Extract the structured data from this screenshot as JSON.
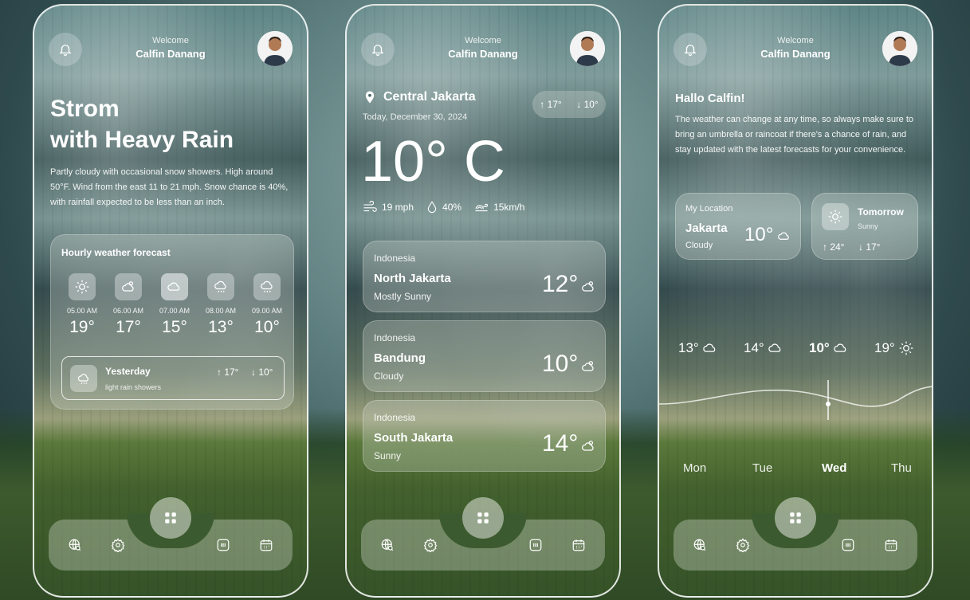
{
  "user": {
    "welcome_label": "Welcome",
    "name": "Calfin Danang"
  },
  "screen1": {
    "title_line1": "Strom",
    "title_line2": "with Heavy Rain",
    "description": "Partly cloudy with occasional snow showers. High around 50°F. Wind from the east 11 to 21 mph. Snow chance is 40%, with rainfall expected to be less than an inch.",
    "hourly_title": "Hourly weather forecast",
    "hourly": [
      {
        "time": "05.00 AM",
        "temp": "19°",
        "icon": "sun-icon"
      },
      {
        "time": "06.00 AM",
        "temp": "17°",
        "icon": "partly-cloudy-icon"
      },
      {
        "time": "07.00 AM",
        "temp": "15°",
        "icon": "cloud-icon"
      },
      {
        "time": "08.00 AM",
        "temp": "13°",
        "icon": "rain-cloud-icon"
      },
      {
        "time": "09.00 AM",
        "temp": "10°",
        "icon": "rain-cloud-icon"
      }
    ],
    "yesterday": {
      "label": "Yesterday",
      "subtitle": "light rain showers",
      "high": "↑ 17°",
      "low": "↓ 10°"
    }
  },
  "screen2": {
    "location": "Central Jakarta",
    "date": "Today, December 30, 2024",
    "high": "↑ 17°",
    "low": "↓ 10°",
    "temperature": "10° C",
    "wind": "19 mph",
    "humidity": "40%",
    "wind_speed": "15km/h",
    "cities": [
      {
        "country": "Indonesia",
        "city": "North Jakarta",
        "condition": "Mostly Sunny",
        "temp": "12°"
      },
      {
        "country": "Indonesia",
        "city": "Bandung",
        "condition": "Cloudy",
        "temp": "10°"
      },
      {
        "country": "Indonesia",
        "city": "South Jakarta",
        "condition": "Sunny",
        "temp": "14°"
      }
    ]
  },
  "screen3": {
    "greeting": "Hallo Calfin!",
    "message": "The weather can change at any time, so always make sure to bring an umbrella or raincoat if there's a chance of rain, and stay updated with the latest forecasts for your convenience.",
    "my_location": {
      "label": "My Location",
      "city": "Jakarta",
      "condition": "Cloudy",
      "temp": "10°"
    },
    "tomorrow": {
      "label": "Tomorrow",
      "condition": "Sunny",
      "high": "↑ 24°",
      "low": "↓ 17°"
    },
    "week_temps": [
      "13°",
      "14°",
      "10°",
      "19°"
    ],
    "days": [
      "Mon",
      "Tue",
      "Wed",
      "Thu"
    ]
  }
}
